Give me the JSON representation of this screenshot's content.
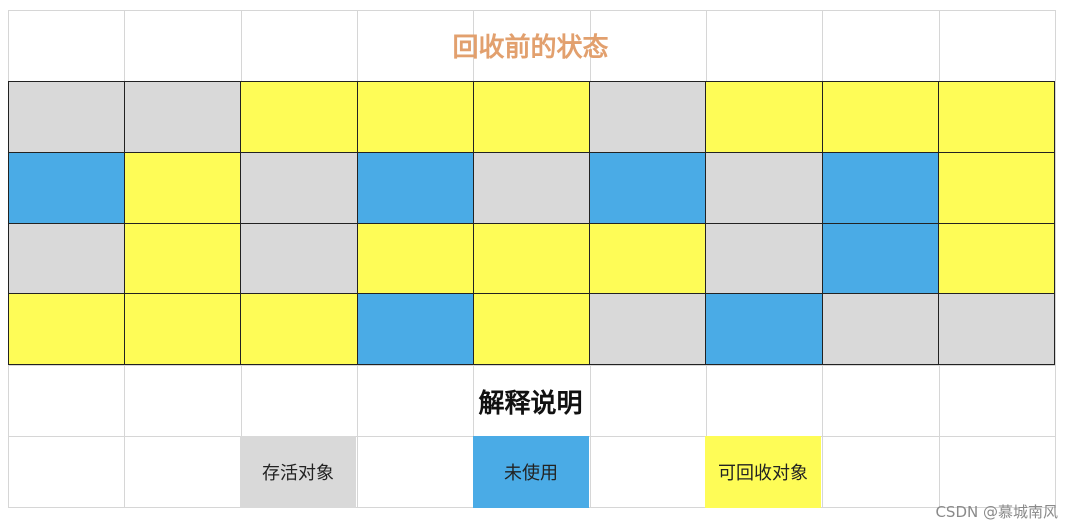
{
  "title": "回收前的状态",
  "legend_heading": "解释说明",
  "colors": {
    "alive": "#d9d9d9",
    "unused": "#4aabe6",
    "recyclable": "#fefc57",
    "title": "#e2a06e"
  },
  "memory_rows": [
    [
      "alive",
      "alive",
      "recyclable",
      "recyclable",
      "recyclable",
      "alive",
      "recyclable",
      "recyclable",
      "recyclable"
    ],
    [
      "unused",
      "recyclable",
      "alive",
      "unused",
      "alive",
      "unused",
      "alive",
      "unused",
      "recyclable"
    ],
    [
      "alive",
      "recyclable",
      "alive",
      "recyclable",
      "recyclable",
      "recyclable",
      "alive",
      "unused",
      "recyclable"
    ],
    [
      "recyclable",
      "recyclable",
      "recyclable",
      "unused",
      "recyclable",
      "alive",
      "unused",
      "alive",
      "alive"
    ]
  ],
  "legend": [
    {
      "state": "alive",
      "label": "存活对象"
    },
    {
      "state": "unused",
      "label": "未使用"
    },
    {
      "state": "recyclable",
      "label": "可回收对象"
    }
  ],
  "watermark": "CSDN @慕城南风"
}
